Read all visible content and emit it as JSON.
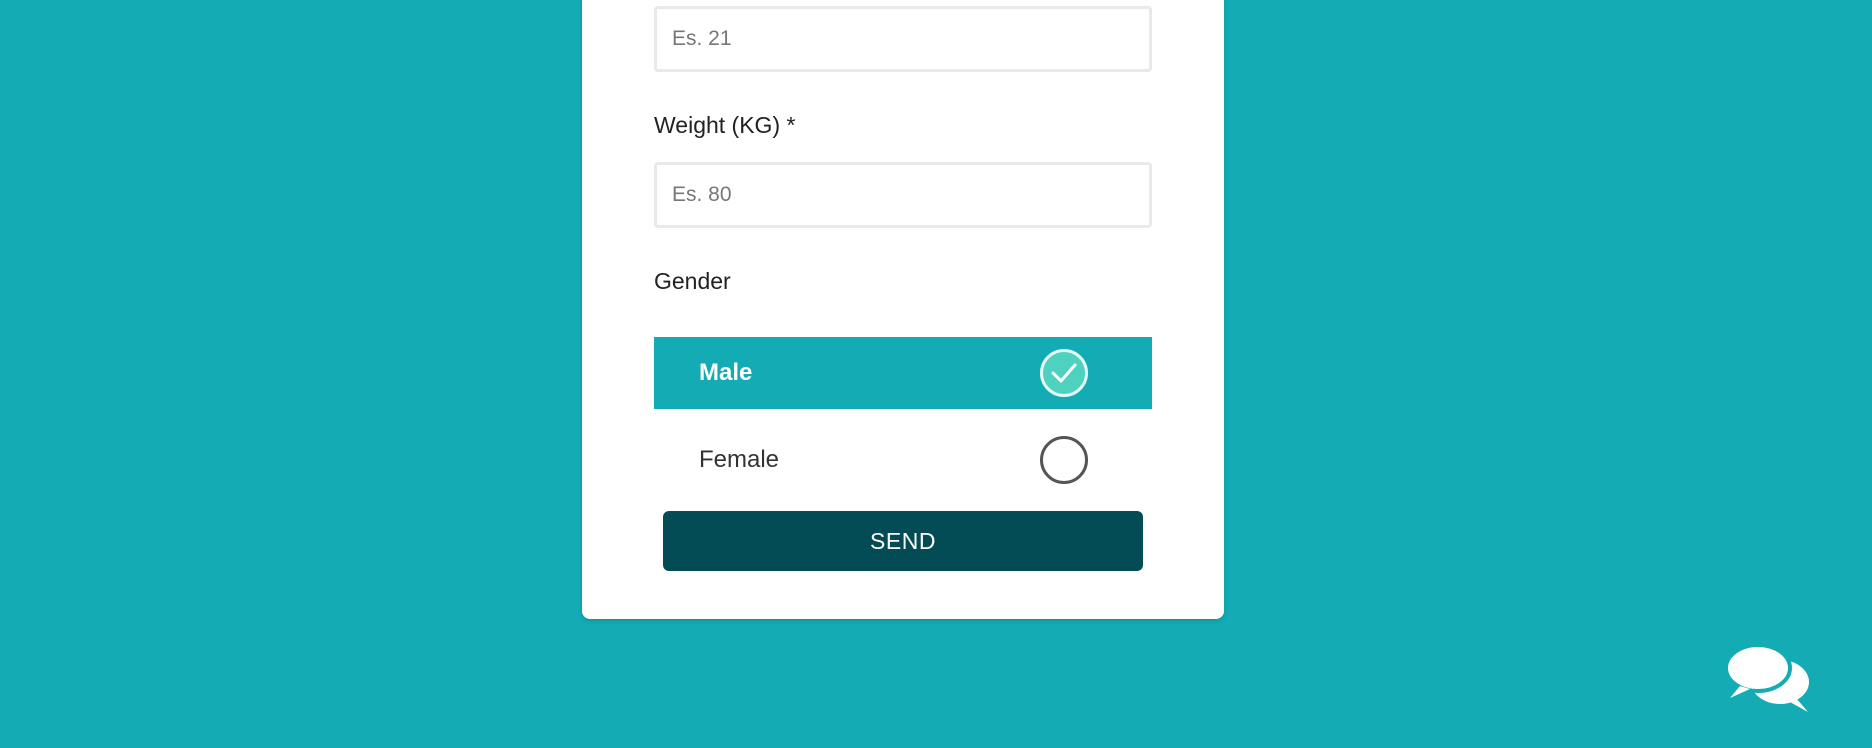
{
  "form": {
    "age_placeholder": "Es. 21",
    "weight_label": "Weight (KG) *",
    "weight_placeholder": "Es. 80",
    "gender_label": "Gender",
    "gender_options": [
      {
        "label": "Male",
        "selected": true
      },
      {
        "label": "Female",
        "selected": false
      }
    ],
    "send_label": "SEND"
  },
  "colors": {
    "background": "#13acb4",
    "selected_option": "#13acb4",
    "selected_radio": "#4fd1c0",
    "send_button": "#044c55"
  },
  "icons": {
    "check": "check-icon",
    "chat": "chat-bubbles-icon"
  }
}
